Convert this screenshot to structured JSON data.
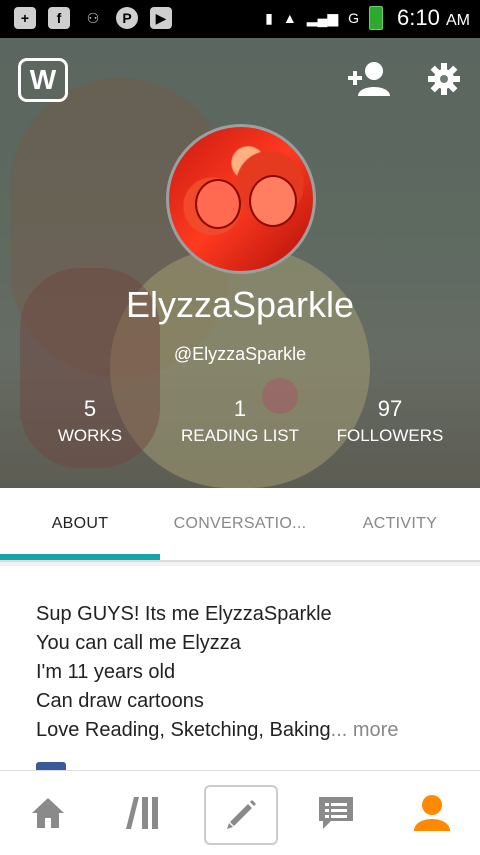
{
  "status_bar": {
    "left_icons": [
      "plus-square-icon",
      "facebook-icon",
      "person-plus-icon",
      "pinterest-icon",
      "youtube-icon"
    ],
    "time": "6:10",
    "ampm": "AM",
    "carrier": "G"
  },
  "header": {
    "logo_letter": "W",
    "username": "ElyzzaSparkle",
    "handle": "@ElyzzaSparkle",
    "stats": [
      {
        "value": "5",
        "label": "WORKS"
      },
      {
        "value": "1",
        "label": "READING LIST"
      },
      {
        "value": "97",
        "label": "FOLLOWERS"
      }
    ]
  },
  "tabs": [
    {
      "label": "ABOUT",
      "active": true
    },
    {
      "label": "CONVERSATIO...",
      "active": false
    },
    {
      "label": "ACTIVITY",
      "active": false
    }
  ],
  "about": {
    "lines": [
      "Sup GUYS! Its me ElyzzaSparkle",
      "You can call me Elyzza",
      "I'm 11 years old",
      "Can draw cartoons",
      "Love Reading, Sketching, Baking"
    ],
    "ellipsis": "...",
    "more_label": "more"
  },
  "bottom_nav": [
    "home-icon",
    "library-icon",
    "write-icon",
    "messages-icon",
    "profile-icon"
  ],
  "colors": {
    "accent": "#17a6a5",
    "active_nav": "#ff8a00",
    "nav_gray": "#8a8a8a"
  }
}
